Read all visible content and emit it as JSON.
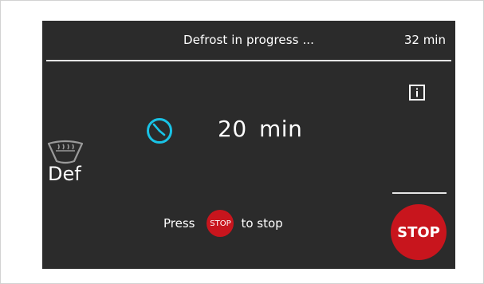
{
  "header": {
    "status_title": "Defrost in progress ...",
    "remaining_time": "32 min"
  },
  "main": {
    "timer_value": "20  min",
    "program_label": "Def",
    "hint_prefix": "Press",
    "hint_badge_label": "STOP",
    "hint_suffix": "to stop"
  },
  "controls": {
    "stop_label": "STOP"
  },
  "icons": {
    "info": "info-icon",
    "timer": "clock-icon",
    "program": "defrost-icon"
  },
  "colors": {
    "screen_background": "#2b2b2b",
    "accent_cyan": "#19c3e6",
    "stop_red": "#c8151d",
    "text": "#ffffff"
  }
}
